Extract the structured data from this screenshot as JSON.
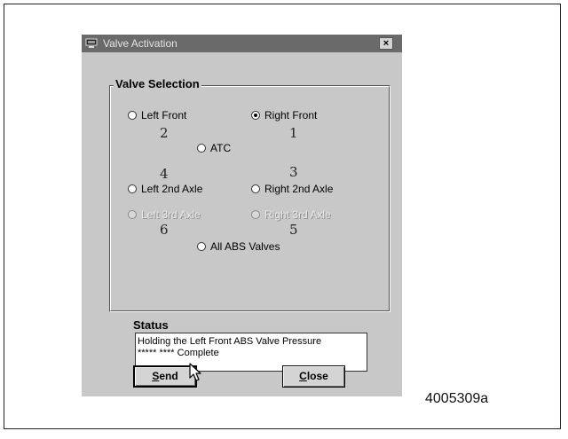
{
  "window": {
    "title": "Valve Activation",
    "close_glyph": "×",
    "icon": "monitor-icon"
  },
  "valve_selection": {
    "legend": "Valve Selection",
    "options": [
      {
        "label": "Left Front",
        "number": "2",
        "selected": false,
        "enabled": true
      },
      {
        "label": "Right Front",
        "number": "1",
        "selected": true,
        "enabled": true
      },
      {
        "label": "ATC",
        "number": "",
        "selected": false,
        "enabled": true
      },
      {
        "label": "Left 2nd Axle",
        "number": "4",
        "selected": false,
        "enabled": true
      },
      {
        "label": "Right 2nd Axle",
        "number": "3",
        "selected": false,
        "enabled": true
      },
      {
        "label": "Left 3rd Axle",
        "number": "6",
        "selected": false,
        "enabled": false
      },
      {
        "label": "Right 3rd Axle",
        "number": "5",
        "selected": false,
        "enabled": false
      },
      {
        "label": "All ABS Valves",
        "number": "",
        "selected": false,
        "enabled": true
      }
    ]
  },
  "status": {
    "label": "Status",
    "lines": [
      "Holding the Left Front ABS Valve Pressure",
      "***** ****  Complete"
    ]
  },
  "buttons": {
    "send": {
      "first": "S",
      "rest": "end"
    },
    "close": {
      "first": "C",
      "rest": "lose"
    }
  },
  "figure_id": "4005309a",
  "colors": {
    "titlebar": "#6a6a6a",
    "dialog_bg": "#c8c8c8",
    "frame": "#222222"
  }
}
